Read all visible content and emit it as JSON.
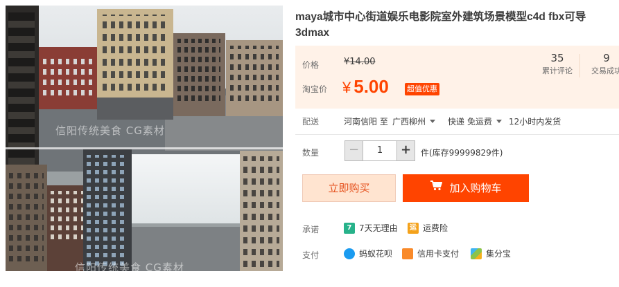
{
  "product": {
    "title": "maya城市中心街道娱乐电影院室外建筑场景模型c4d fbx可导3dmax",
    "image": {
      "watermark_top": "信阳传统美食 CG素材",
      "watermark_bottom": "信阳传统美食 CG素材"
    }
  },
  "price": {
    "original_label": "价格",
    "original_price": "¥14.00",
    "promo_label": "淘宝价",
    "currency": "¥",
    "promo_price": "5.00",
    "promo_badge": "超值优惠",
    "accent_color": "#ff4400"
  },
  "stats": {
    "reviews_count": "35",
    "reviews_label": "累计评论",
    "deals_count": "9",
    "deals_label": "交易成功"
  },
  "shipping": {
    "label": "配送",
    "from": "河南信阳 至",
    "to": "广西柳州",
    "method": "快递 免运费",
    "dispatch": "12小时内发货"
  },
  "quantity": {
    "label": "数量",
    "value": "1",
    "minus": "−",
    "plus": "+",
    "stock": "件(库存99999829件)"
  },
  "actions": {
    "buy_now": "立即购买",
    "add_to_cart": "加入购物车"
  },
  "promise": {
    "label": "承诺",
    "items": [
      {
        "icon": "seven-day-return-icon",
        "glyph": "7",
        "text": "7天无理由"
      },
      {
        "icon": "shipping-insurance-icon",
        "glyph": "运",
        "text": "运费险"
      }
    ]
  },
  "payment": {
    "label": "支付",
    "items": [
      {
        "icon": "huabei-icon",
        "text": "蚂蚁花呗"
      },
      {
        "icon": "credit-card-icon",
        "text": "信用卡支付"
      },
      {
        "icon": "jifenbao-icon",
        "text": "集分宝"
      }
    ]
  }
}
